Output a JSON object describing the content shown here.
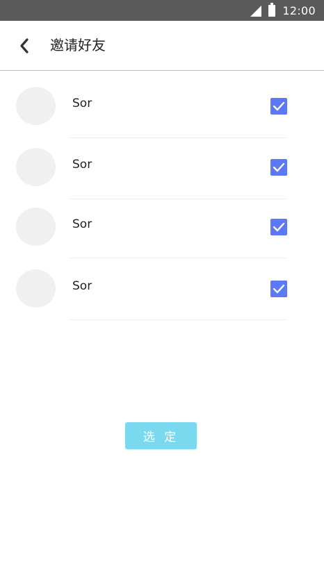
{
  "status_bar": {
    "time": "12:00",
    "signal_icon": "signal-icon",
    "battery_icon": "battery-icon"
  },
  "header": {
    "back_icon": "chevron-left-icon",
    "title": "邀请好友"
  },
  "friends": [
    {
      "name": "Sor",
      "checked": true
    },
    {
      "name": "Sor",
      "checked": true
    },
    {
      "name": "Sor",
      "checked": true
    },
    {
      "name": "Sor",
      "checked": true
    }
  ],
  "confirm_button": {
    "label": "选 定"
  },
  "colors": {
    "status_bar": "#5a5a5a",
    "checkbox": "#5b78f6",
    "confirm_button": "#7ad9ef",
    "avatar_placeholder": "#f0f0f0"
  }
}
